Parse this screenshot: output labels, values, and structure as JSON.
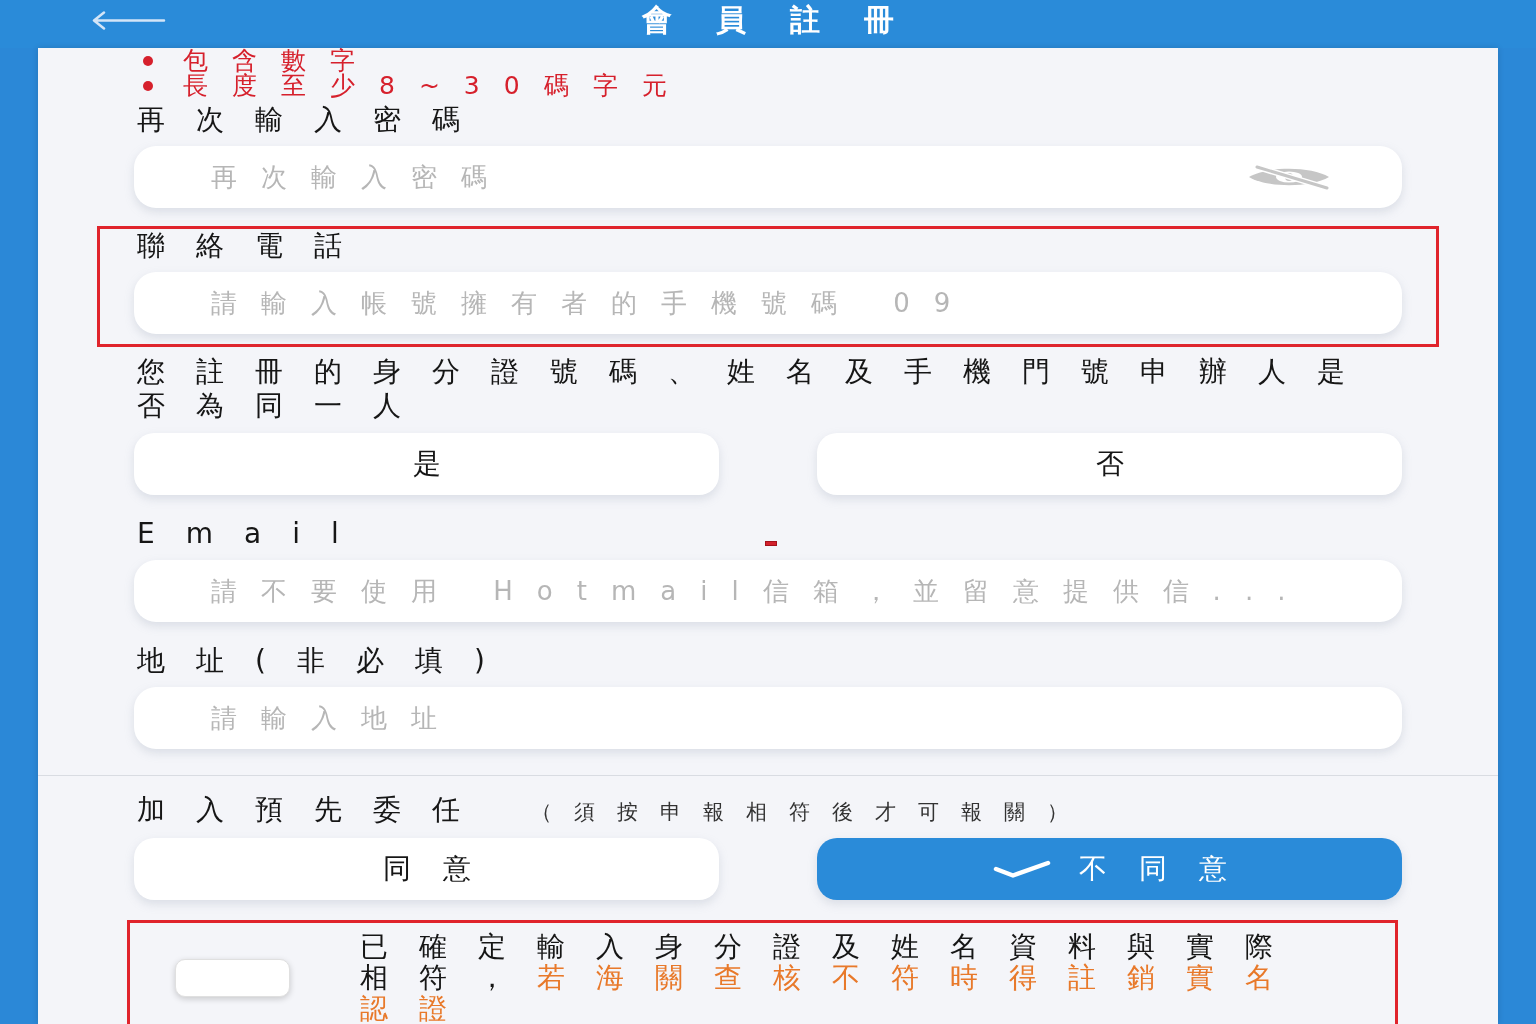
{
  "header": {
    "title": "會員註冊"
  },
  "password_rules": [
    "包含數字",
    "長度至少8~30碼字元"
  ],
  "confirm_password": {
    "label": "再次輸入密碼",
    "placeholder": "再次輸入密碼"
  },
  "phone": {
    "label": "聯絡電話",
    "placeholder": "請輸入帳號擁有者的手機號碼 09",
    "highlighted": true
  },
  "same_person": {
    "question": "您註冊的身分證號碼、姓名及手機門號申辦人是否為同一人",
    "options": [
      {
        "label": "是",
        "selected": false
      },
      {
        "label": "否",
        "selected": false
      }
    ]
  },
  "email": {
    "label": "Email",
    "placeholder": "請不要使用 Hotmail信箱，並留意提供信..."
  },
  "address": {
    "label": "地址(非必填)",
    "placeholder": "請輸入地址"
  },
  "delegation": {
    "label": "加入預先委任",
    "note": "（須按申報相符後才可報關）",
    "options": [
      {
        "label": "同意",
        "selected": false
      },
      {
        "label": "不同意",
        "selected": true
      }
    ]
  },
  "agreement": {
    "checked": false,
    "highlighted": true,
    "text": "已確定輸入身分證及姓名資料與實際相符，",
    "warning": "若海關查核不符時得註銷實名認證"
  }
}
